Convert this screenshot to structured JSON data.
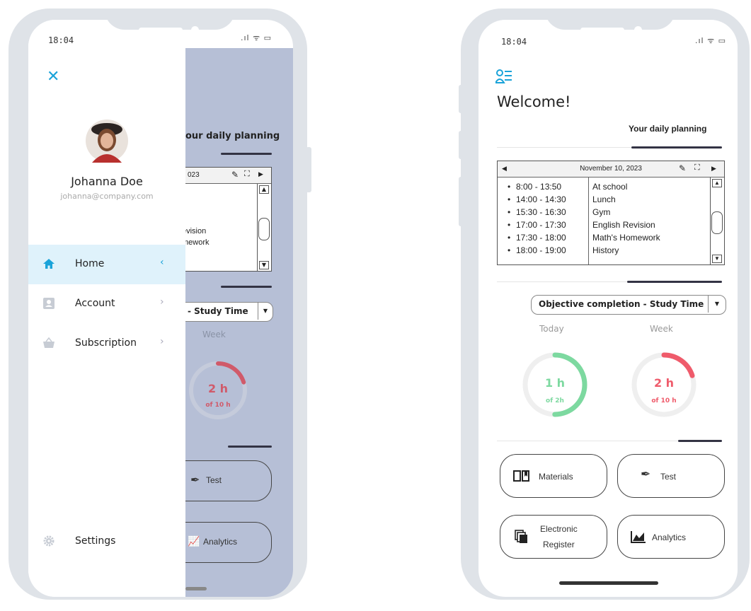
{
  "status": {
    "time": "18:04",
    "signal": ".ıl ᯤ ▭"
  },
  "drawer": {
    "user_name": "Johanna Doe",
    "user_email": "johanna@company.com",
    "menu": [
      {
        "label": "Home",
        "icon": "home-icon",
        "active": true
      },
      {
        "label": "Account",
        "icon": "account-icon"
      },
      {
        "label": "Subscription",
        "icon": "basket-icon"
      }
    ],
    "settings_label": "Settings"
  },
  "behind": {
    "planning": "our daily planning",
    "cal_date": "023",
    "items": [
      "evision",
      "mework"
    ],
    "select": "- Study Time",
    "week_label": "Week",
    "week_value": "2 h",
    "week_sub": "of 10 h",
    "test": "Test",
    "analytics": "Analytics"
  },
  "main": {
    "title": "Welcome!",
    "planning_tab": "Your daily planning",
    "calendar": {
      "date": "November 10, 2023",
      "events": [
        {
          "time": "8:00 - 13:50",
          "title": "At school"
        },
        {
          "time": "14:00 - 14:30",
          "title": "Lunch"
        },
        {
          "time": "15:30 - 16:30",
          "title": "Gym"
        },
        {
          "time": "17:00 - 17:30",
          "title": "English Revision"
        },
        {
          "time": "17:30 - 18:00",
          "title": "Math's Homework"
        },
        {
          "time": "18:00 - 19:00",
          "title": "History"
        }
      ]
    },
    "objective_select": "Objective completion - Study Time",
    "today": {
      "label": "Today",
      "value": "1 h",
      "sub": "of 2h",
      "progress": 0.5,
      "color": "#7dd9a0"
    },
    "week": {
      "label": "Week",
      "value": "2 h",
      "sub": "of 10 h",
      "progress": 0.2,
      "color": "#ef5b6b"
    },
    "buttons": {
      "materials": "Materials",
      "test": "Test",
      "register_line1": "Electronic",
      "register_line2": "Register",
      "analytics": "Analytics"
    }
  },
  "colors": {
    "accent": "#1aa3d9",
    "frame": "#dfe3e8",
    "overlay": "#b6bfd6",
    "active_bg": "#dff2fb"
  }
}
